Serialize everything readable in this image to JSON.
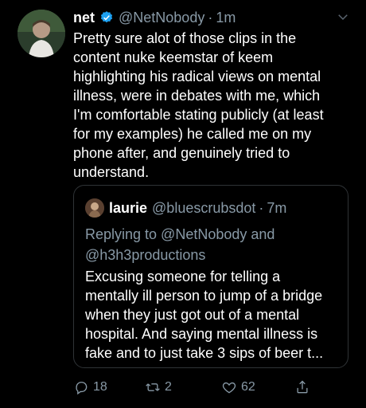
{
  "tweet": {
    "author_name": "net",
    "author_handle": "@NetNobody",
    "separator": "·",
    "time": "1m",
    "lines": [
      "Pretty sure alot of those clips in the",
      "content nuke keemstar of keem",
      "highlighting his radical views on mental",
      "illness, were in debates with me, which",
      "I'm comfortable stating publicly (at least",
      "for my examples) he called me on my",
      "phone after, and genuinely tried to",
      "understand."
    ]
  },
  "quote": {
    "author_name": "laurie",
    "author_handle": "@bluescrubsdot",
    "separator": "·",
    "time": "7m",
    "replying_lines": [
      "Replying to @NetNobody and",
      "@h3h3productions"
    ],
    "lines": [
      "Excusing someone for telling a",
      "mentally ill person to jump of a bridge",
      "when they just got out of a mental",
      "hospital. And saying mental illness is",
      "fake and to just take 3 sips of beer t..."
    ]
  },
  "actions": {
    "reply_count": "18",
    "retweet_count": "2",
    "like_count": "62"
  },
  "colors": {
    "background": "#000000",
    "verified": "#1da1f2",
    "secondary_text": "#8899a6",
    "border": "#2f3336"
  },
  "icons": [
    "verified-badge-icon",
    "chevron-down-icon",
    "reply-icon",
    "retweet-icon",
    "like-icon",
    "share-icon"
  ]
}
